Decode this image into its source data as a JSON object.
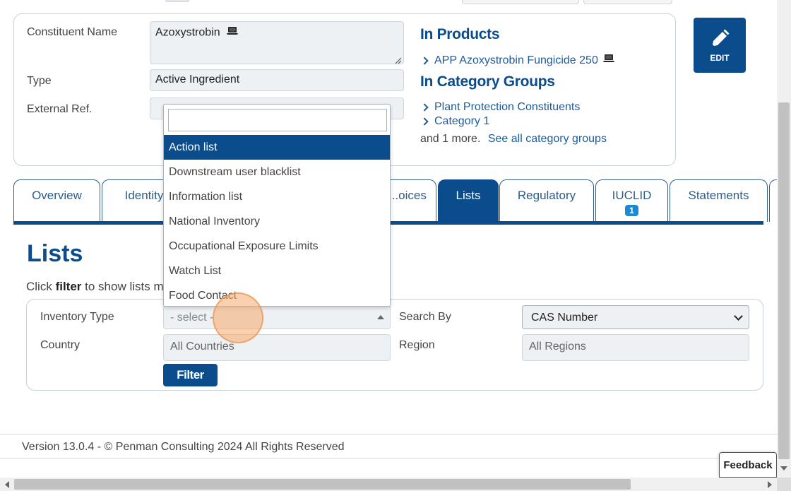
{
  "constituent": {
    "name_label": "Constituent Name",
    "name_value": "Azoxystrobin",
    "type_label": "Type",
    "type_value": "Active Ingredient",
    "extref_label": "External Ref."
  },
  "products": {
    "heading": "In Products",
    "items": [
      "APP Azoxystrobin Fungicide 250"
    ]
  },
  "category_groups": {
    "heading": "In Category Groups",
    "items": [
      "Plant Protection Constituents",
      "Category 1"
    ],
    "more_text": "and 1 more.",
    "see_all": "See all category groups"
  },
  "edit_label": "EDIT",
  "tabs": [
    {
      "label": "Overview"
    },
    {
      "label": "Identity"
    },
    {
      "label": "...oices"
    },
    {
      "label": "Lists"
    },
    {
      "label": "Regulatory"
    },
    {
      "label": "IUCLID",
      "badge": "1"
    },
    {
      "label": "Statements"
    }
  ],
  "lists": {
    "title": "Lists",
    "hint_prefix": "Click",
    "hint_bold": "filter",
    "hint_rest": "to show lists m"
  },
  "filter": {
    "inventory_label": "Inventory Type",
    "inventory_value": "- select -",
    "search_by_label": "Search By",
    "search_by_value": "CAS Number",
    "country_label": "Country",
    "country_placeholder": "All Countries",
    "region_label": "Region",
    "region_placeholder": "All Regions",
    "button_label": "Filter"
  },
  "dropdown": {
    "options": [
      "Action list",
      "Downstream user blacklist",
      "Information list",
      "National Inventory",
      "Occupational Exposure Limits",
      "Watch List",
      "Food Contact"
    ],
    "selected_index": 0
  },
  "footer": {
    "version_text": "Version 13.0.4 - © Penman Consulting 2024 All Rights Reserved",
    "feedback_label": "Feedback"
  },
  "colors": {
    "primary": "#0b4c8c",
    "link": "#1d5c9a",
    "badge": "#1a8bd3"
  }
}
